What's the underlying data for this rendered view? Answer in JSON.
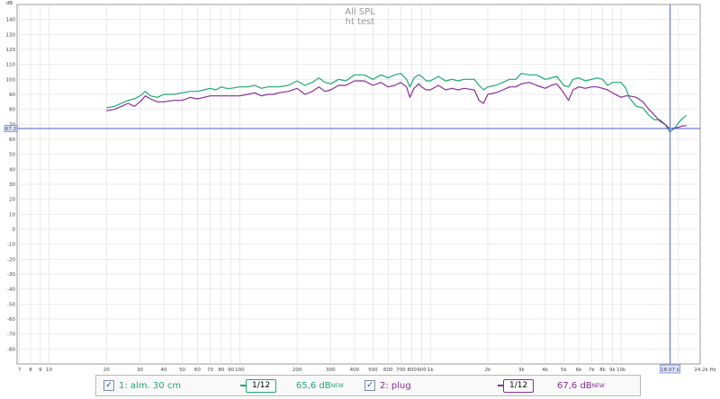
{
  "header": {
    "title": "All SPL",
    "subtitle": "ht test"
  },
  "chart_data": {
    "type": "line",
    "title": "All SPL",
    "subtitle": "ht test",
    "ylabel": "dB",
    "xunit": "Hz",
    "xscale": "log",
    "xlim": [
      6.8,
      26000
    ],
    "ylim": [
      -90,
      150
    ],
    "x_ticks": [
      {
        "v": 7,
        "label": "7"
      },
      {
        "v": 8,
        "label": "8"
      },
      {
        "v": 9,
        "label": "9"
      },
      {
        "v": 10,
        "label": "10"
      },
      {
        "v": 20,
        "label": "20"
      },
      {
        "v": 30,
        "label": "30"
      },
      {
        "v": 40,
        "label": "40"
      },
      {
        "v": 50,
        "label": "50"
      },
      {
        "v": 60,
        "label": "60"
      },
      {
        "v": 70,
        "label": "70"
      },
      {
        "v": 80,
        "label": "80"
      },
      {
        "v": 90,
        "label": "90"
      },
      {
        "v": 100,
        "label": "100"
      },
      {
        "v": 200,
        "label": "200"
      },
      {
        "v": 300,
        "label": "300"
      },
      {
        "v": 400,
        "label": "400"
      },
      {
        "v": 500,
        "label": "500"
      },
      {
        "v": 600,
        "label": "600"
      },
      {
        "v": 700,
        "label": "700"
      },
      {
        "v": 800,
        "label": "800"
      },
      {
        "v": 900,
        "label": "900"
      },
      {
        "v": 1000,
        "label": "1k"
      },
      {
        "v": 2000,
        "label": "2k"
      },
      {
        "v": 3000,
        "label": "3k"
      },
      {
        "v": 4000,
        "label": "4k"
      },
      {
        "v": 5000,
        "label": "5k"
      },
      {
        "v": 6000,
        "label": "6k"
      },
      {
        "v": 7000,
        "label": "7k"
      },
      {
        "v": 8000,
        "label": "8k"
      },
      {
        "v": 9000,
        "label": "9k"
      },
      {
        "v": 10000,
        "label": "10k"
      },
      {
        "v": 24200,
        "label": "24.2k Hz"
      }
    ],
    "y_ticks": [
      140,
      130,
      120,
      110,
      100,
      90,
      80,
      70,
      60,
      50,
      40,
      30,
      20,
      10,
      0,
      -10,
      -20,
      -30,
      -40,
      -50,
      -60,
      -70,
      -80
    ],
    "cursor": {
      "freq": 18070,
      "freq_label": "18.07 k",
      "spl": 67.2,
      "spl_label": "67.2"
    },
    "series": [
      {
        "name": "1: alm. 30 cm",
        "color": "#1ea870",
        "points": [
          [
            20,
            81
          ],
          [
            22,
            82
          ],
          [
            24,
            84
          ],
          [
            26,
            86
          ],
          [
            28,
            87
          ],
          [
            30,
            89
          ],
          [
            32,
            92
          ],
          [
            34,
            89
          ],
          [
            37,
            88
          ],
          [
            40,
            90
          ],
          [
            45,
            90
          ],
          [
            50,
            91
          ],
          [
            55,
            92
          ],
          [
            60,
            92
          ],
          [
            65,
            93
          ],
          [
            70,
            94
          ],
          [
            75,
            93
          ],
          [
            80,
            95
          ],
          [
            85,
            94
          ],
          [
            90,
            94
          ],
          [
            100,
            95
          ],
          [
            110,
            95
          ],
          [
            120,
            96
          ],
          [
            130,
            94
          ],
          [
            140,
            95
          ],
          [
            150,
            95
          ],
          [
            160,
            95
          ],
          [
            180,
            96
          ],
          [
            200,
            99
          ],
          [
            220,
            96
          ],
          [
            240,
            98
          ],
          [
            260,
            101
          ],
          [
            280,
            98
          ],
          [
            300,
            97
          ],
          [
            330,
            100
          ],
          [
            360,
            99
          ],
          [
            400,
            103
          ],
          [
            450,
            103
          ],
          [
            500,
            100
          ],
          [
            550,
            103
          ],
          [
            600,
            101
          ],
          [
            650,
            103
          ],
          [
            700,
            104
          ],
          [
            750,
            100
          ],
          [
            780,
            95
          ],
          [
            820,
            101
          ],
          [
            870,
            103
          ],
          [
            900,
            102
          ],
          [
            950,
            99
          ],
          [
            1000,
            99
          ],
          [
            1100,
            102
          ],
          [
            1200,
            99
          ],
          [
            1300,
            100
          ],
          [
            1400,
            99
          ],
          [
            1500,
            100
          ],
          [
            1700,
            100
          ],
          [
            1800,
            96
          ],
          [
            1900,
            93
          ],
          [
            2000,
            95
          ],
          [
            2200,
            96
          ],
          [
            2400,
            98
          ],
          [
            2600,
            100
          ],
          [
            2800,
            100
          ],
          [
            3000,
            104
          ],
          [
            3300,
            103
          ],
          [
            3600,
            103
          ],
          [
            4000,
            100
          ],
          [
            4300,
            101
          ],
          [
            4600,
            102
          ],
          [
            5000,
            96
          ],
          [
            5300,
            95
          ],
          [
            5600,
            100
          ],
          [
            6000,
            101
          ],
          [
            6500,
            99
          ],
          [
            7000,
            100
          ],
          [
            7500,
            101
          ],
          [
            8000,
            100
          ],
          [
            8500,
            96
          ],
          [
            9000,
            98
          ],
          [
            10000,
            98
          ],
          [
            10600,
            94
          ],
          [
            11000,
            88
          ],
          [
            12000,
            82
          ],
          [
            13000,
            81
          ],
          [
            14000,
            76
          ],
          [
            15000,
            73
          ],
          [
            16000,
            73
          ],
          [
            17000,
            70
          ],
          [
            18000,
            65
          ],
          [
            19000,
            67
          ],
          [
            20000,
            71
          ],
          [
            21000,
            74
          ],
          [
            22000,
            76
          ]
        ]
      },
      {
        "name": "2: plug",
        "color": "#8a2d9a",
        "points": [
          [
            20,
            79
          ],
          [
            22,
            80
          ],
          [
            24,
            82
          ],
          [
            26,
            84
          ],
          [
            28,
            82
          ],
          [
            30,
            85
          ],
          [
            32,
            89
          ],
          [
            34,
            87
          ],
          [
            37,
            85
          ],
          [
            40,
            85
          ],
          [
            45,
            86
          ],
          [
            50,
            86
          ],
          [
            55,
            88
          ],
          [
            60,
            87
          ],
          [
            65,
            88
          ],
          [
            70,
            89
          ],
          [
            75,
            89
          ],
          [
            80,
            89
          ],
          [
            85,
            89
          ],
          [
            90,
            89
          ],
          [
            100,
            89
          ],
          [
            110,
            90
          ],
          [
            120,
            91
          ],
          [
            130,
            89
          ],
          [
            140,
            90
          ],
          [
            150,
            90
          ],
          [
            160,
            91
          ],
          [
            180,
            92
          ],
          [
            200,
            94
          ],
          [
            220,
            90
          ],
          [
            240,
            92
          ],
          [
            260,
            95
          ],
          [
            280,
            92
          ],
          [
            300,
            93
          ],
          [
            330,
            96
          ],
          [
            360,
            96
          ],
          [
            400,
            99
          ],
          [
            450,
            99
          ],
          [
            500,
            96
          ],
          [
            550,
            98
          ],
          [
            600,
            95
          ],
          [
            650,
            96
          ],
          [
            700,
            98
          ],
          [
            750,
            95
          ],
          [
            780,
            88
          ],
          [
            820,
            94
          ],
          [
            870,
            97
          ],
          [
            900,
            95
          ],
          [
            950,
            93
          ],
          [
            1000,
            93
          ],
          [
            1100,
            96
          ],
          [
            1200,
            93
          ],
          [
            1300,
            94
          ],
          [
            1400,
            93
          ],
          [
            1500,
            94
          ],
          [
            1700,
            93
          ],
          [
            1800,
            86
          ],
          [
            1900,
            84
          ],
          [
            2000,
            90
          ],
          [
            2200,
            91
          ],
          [
            2400,
            93
          ],
          [
            2600,
            95
          ],
          [
            2800,
            95
          ],
          [
            3000,
            97
          ],
          [
            3300,
            98
          ],
          [
            3600,
            96
          ],
          [
            4000,
            94
          ],
          [
            4300,
            96
          ],
          [
            4600,
            97
          ],
          [
            5000,
            91
          ],
          [
            5300,
            86
          ],
          [
            5600,
            93
          ],
          [
            6000,
            95
          ],
          [
            6500,
            94
          ],
          [
            7000,
            95
          ],
          [
            7500,
            95
          ],
          [
            8000,
            94
          ],
          [
            8500,
            93
          ],
          [
            9000,
            91
          ],
          [
            10000,
            88
          ],
          [
            10600,
            89
          ],
          [
            11000,
            89
          ],
          [
            12000,
            88
          ],
          [
            13000,
            85
          ],
          [
            14000,
            80
          ],
          [
            15000,
            76
          ],
          [
            16000,
            72
          ],
          [
            17000,
            70
          ],
          [
            18000,
            67
          ],
          [
            19000,
            67.5
          ],
          [
            20000,
            68
          ],
          [
            21000,
            69
          ],
          [
            22000,
            69
          ]
        ]
      }
    ]
  },
  "legend": {
    "items": [
      {
        "label": "1: alm. 30 cm",
        "checked": "✓",
        "smoothing": "1/12",
        "level": "65,6 dB",
        "level_tag": "NEW",
        "color": "#1ea870"
      },
      {
        "label": "2: plug",
        "checked": "✓",
        "smoothing": "1/12",
        "level": "67,6 dB",
        "level_tag": "NEW",
        "color": "#8a2d9a"
      }
    ]
  }
}
